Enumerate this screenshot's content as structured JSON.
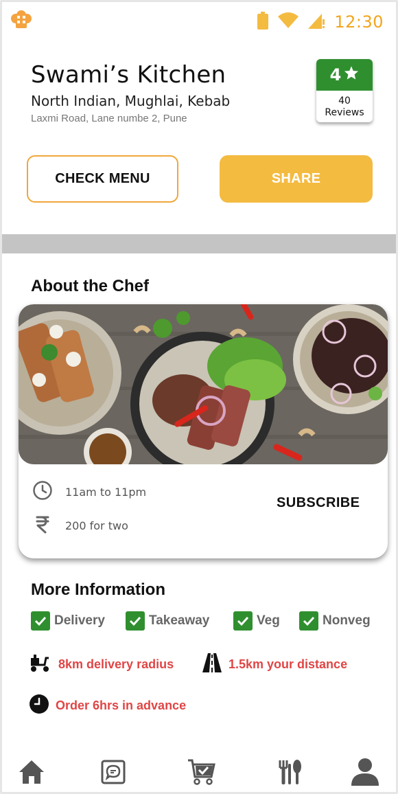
{
  "status": {
    "time": "12:30"
  },
  "restaurant": {
    "name": "Swami’s Kitchen",
    "cuisines": "North Indian, Mughlai, Kebab",
    "address": "Laxmi Road, Lane numbe 2, Pune",
    "rating": "4",
    "reviews_count": "40",
    "reviews_label": "Reviews"
  },
  "actions": {
    "menu_label": "CHECK MENU",
    "share_label": "SHARE"
  },
  "chef": {
    "section_title": "About the Chef",
    "hours": "11am to 11pm",
    "price": "200 for two",
    "subscribe_label": "SUBSCRIBE"
  },
  "more_info": {
    "section_title": "More Information",
    "tags": [
      "Delivery",
      "Takeaway",
      "Veg",
      "Nonveg"
    ],
    "delivery_radius": "8km delivery radius",
    "distance": "1.5km your distance",
    "advance": "Order 6hrs in advance"
  },
  "nav": {
    "items": [
      "home-icon",
      "chat-icon",
      "cart-icon",
      "cutlery-icon",
      "profile-icon"
    ]
  },
  "colors": {
    "accent": "#f4bb41",
    "accent_orange": "#f0a73a",
    "green": "#2f8f2f",
    "red": "#e04545",
    "divider": "#c4c4c4"
  }
}
